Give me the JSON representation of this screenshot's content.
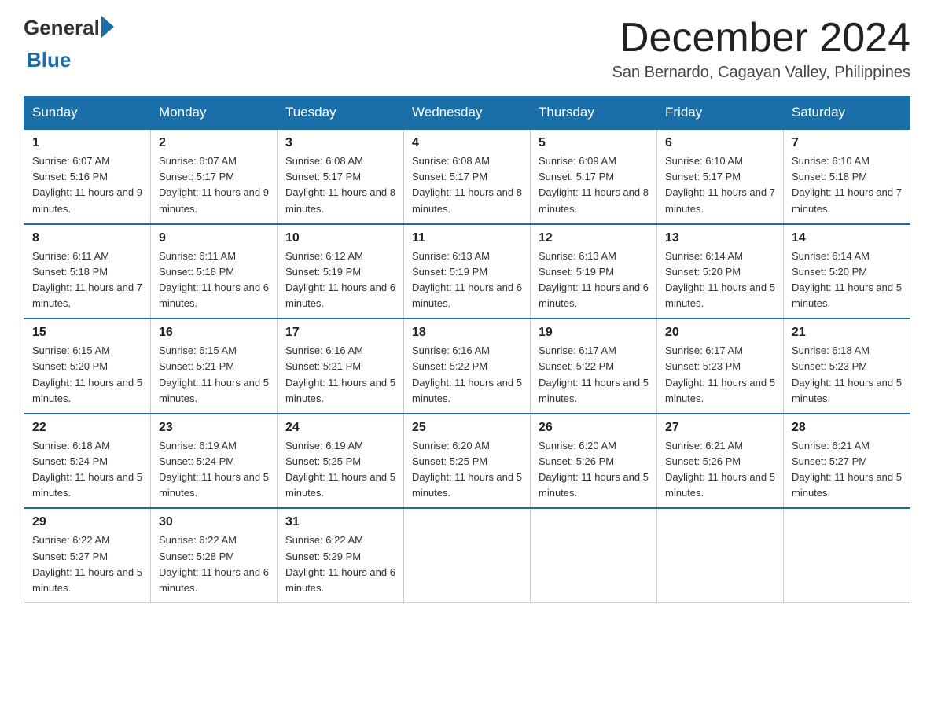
{
  "logo": {
    "general": "General",
    "blue": "Blue",
    "arrow_color": "#1a6fa8"
  },
  "title": {
    "month_year": "December 2024",
    "location": "San Bernardo, Cagayan Valley, Philippines"
  },
  "days_header": [
    "Sunday",
    "Monday",
    "Tuesday",
    "Wednesday",
    "Thursday",
    "Friday",
    "Saturday"
  ],
  "weeks": [
    [
      {
        "day": "1",
        "sunrise": "6:07 AM",
        "sunset": "5:16 PM",
        "daylight": "11 hours and 9 minutes."
      },
      {
        "day": "2",
        "sunrise": "6:07 AM",
        "sunset": "5:17 PM",
        "daylight": "11 hours and 9 minutes."
      },
      {
        "day": "3",
        "sunrise": "6:08 AM",
        "sunset": "5:17 PM",
        "daylight": "11 hours and 8 minutes."
      },
      {
        "day": "4",
        "sunrise": "6:08 AM",
        "sunset": "5:17 PM",
        "daylight": "11 hours and 8 minutes."
      },
      {
        "day": "5",
        "sunrise": "6:09 AM",
        "sunset": "5:17 PM",
        "daylight": "11 hours and 8 minutes."
      },
      {
        "day": "6",
        "sunrise": "6:10 AM",
        "sunset": "5:17 PM",
        "daylight": "11 hours and 7 minutes."
      },
      {
        "day": "7",
        "sunrise": "6:10 AM",
        "sunset": "5:18 PM",
        "daylight": "11 hours and 7 minutes."
      }
    ],
    [
      {
        "day": "8",
        "sunrise": "6:11 AM",
        "sunset": "5:18 PM",
        "daylight": "11 hours and 7 minutes."
      },
      {
        "day": "9",
        "sunrise": "6:11 AM",
        "sunset": "5:18 PM",
        "daylight": "11 hours and 6 minutes."
      },
      {
        "day": "10",
        "sunrise": "6:12 AM",
        "sunset": "5:19 PM",
        "daylight": "11 hours and 6 minutes."
      },
      {
        "day": "11",
        "sunrise": "6:13 AM",
        "sunset": "5:19 PM",
        "daylight": "11 hours and 6 minutes."
      },
      {
        "day": "12",
        "sunrise": "6:13 AM",
        "sunset": "5:19 PM",
        "daylight": "11 hours and 6 minutes."
      },
      {
        "day": "13",
        "sunrise": "6:14 AM",
        "sunset": "5:20 PM",
        "daylight": "11 hours and 5 minutes."
      },
      {
        "day": "14",
        "sunrise": "6:14 AM",
        "sunset": "5:20 PM",
        "daylight": "11 hours and 5 minutes."
      }
    ],
    [
      {
        "day": "15",
        "sunrise": "6:15 AM",
        "sunset": "5:20 PM",
        "daylight": "11 hours and 5 minutes."
      },
      {
        "day": "16",
        "sunrise": "6:15 AM",
        "sunset": "5:21 PM",
        "daylight": "11 hours and 5 minutes."
      },
      {
        "day": "17",
        "sunrise": "6:16 AM",
        "sunset": "5:21 PM",
        "daylight": "11 hours and 5 minutes."
      },
      {
        "day": "18",
        "sunrise": "6:16 AM",
        "sunset": "5:22 PM",
        "daylight": "11 hours and 5 minutes."
      },
      {
        "day": "19",
        "sunrise": "6:17 AM",
        "sunset": "5:22 PM",
        "daylight": "11 hours and 5 minutes."
      },
      {
        "day": "20",
        "sunrise": "6:17 AM",
        "sunset": "5:23 PM",
        "daylight": "11 hours and 5 minutes."
      },
      {
        "day": "21",
        "sunrise": "6:18 AM",
        "sunset": "5:23 PM",
        "daylight": "11 hours and 5 minutes."
      }
    ],
    [
      {
        "day": "22",
        "sunrise": "6:18 AM",
        "sunset": "5:24 PM",
        "daylight": "11 hours and 5 minutes."
      },
      {
        "day": "23",
        "sunrise": "6:19 AM",
        "sunset": "5:24 PM",
        "daylight": "11 hours and 5 minutes."
      },
      {
        "day": "24",
        "sunrise": "6:19 AM",
        "sunset": "5:25 PM",
        "daylight": "11 hours and 5 minutes."
      },
      {
        "day": "25",
        "sunrise": "6:20 AM",
        "sunset": "5:25 PM",
        "daylight": "11 hours and 5 minutes."
      },
      {
        "day": "26",
        "sunrise": "6:20 AM",
        "sunset": "5:26 PM",
        "daylight": "11 hours and 5 minutes."
      },
      {
        "day": "27",
        "sunrise": "6:21 AM",
        "sunset": "5:26 PM",
        "daylight": "11 hours and 5 minutes."
      },
      {
        "day": "28",
        "sunrise": "6:21 AM",
        "sunset": "5:27 PM",
        "daylight": "11 hours and 5 minutes."
      }
    ],
    [
      {
        "day": "29",
        "sunrise": "6:22 AM",
        "sunset": "5:27 PM",
        "daylight": "11 hours and 5 minutes."
      },
      {
        "day": "30",
        "sunrise": "6:22 AM",
        "sunset": "5:28 PM",
        "daylight": "11 hours and 6 minutes."
      },
      {
        "day": "31",
        "sunrise": "6:22 AM",
        "sunset": "5:29 PM",
        "daylight": "11 hours and 6 minutes."
      },
      null,
      null,
      null,
      null
    ]
  ]
}
